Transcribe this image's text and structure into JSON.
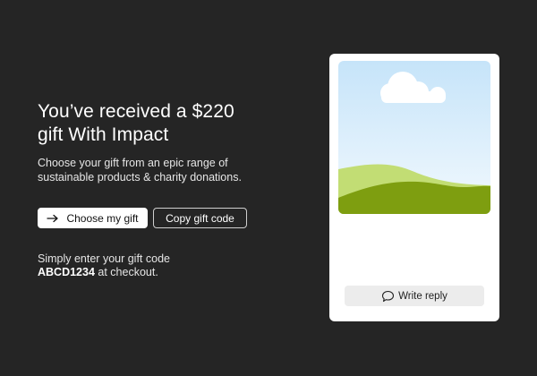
{
  "hero": {
    "headline_line1": "You’ve received a $220",
    "headline_line2": "gift With Impact",
    "subtext": "Choose your gift from an epic range of sustainable products & charity donations.",
    "primary_button": {
      "label": "Choose my gift",
      "icon": "arrow-right-icon"
    },
    "secondary_button": {
      "label": "Copy gift code"
    },
    "instructions_prefix": "Simply enter your gift code",
    "gift_code": "ABCD1234",
    "instructions_suffix": " at checkout."
  },
  "card": {
    "image": "landscape-illustration",
    "reply_button": {
      "label": "Write reply",
      "icon": "speech-bubble-icon"
    }
  },
  "colors": {
    "background": "#252525",
    "card_background": "#ffffff",
    "sky_top": "#c6e4f9",
    "sky_bottom": "#f2f9fe",
    "hill_light": "#c2dd74",
    "hill_dark": "#7e9e10",
    "reply_button_bg": "#ececec"
  }
}
